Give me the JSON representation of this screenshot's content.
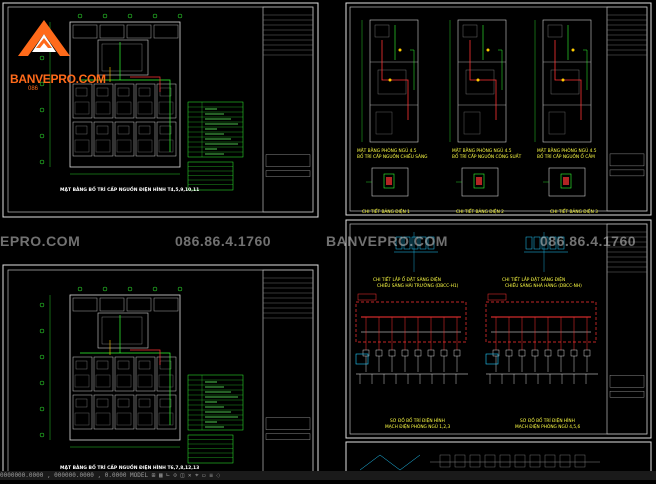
{
  "watermarks": {
    "banvepro_left": "EPRO.COM",
    "phone_left": "086.86.4.1760",
    "banvepro_right": "BANVEPRO.COM",
    "phone_right": "086.86.4.1760"
  },
  "logo": {
    "name": "BANVEPRO.COM",
    "phone": "086"
  },
  "sheets": {
    "sheet1": {
      "title": "MẶT BẰNG BỐ TRÍ CẤP NGUỒN ĐIỆN HÌNH T4,5,9,10,11",
      "legend_title": "GHI CHÚ"
    },
    "sheet2": {
      "plan1": "MẶT BẰNG PHÒNG NGỦ 4.5",
      "plan1_sub": "BỐ TRÍ CẤP NGUỒN CHIẾU SÁNG",
      "plan2": "MẶT BẰNG PHÒNG NGỦ 4.5",
      "plan2_sub": "BỐ TRÍ CẤP NGUỒN CÔNG SUẤT",
      "plan3": "MẶT BẰNG PHÒNG NGỦ 4.5",
      "plan3_sub": "BỐ TRÍ CẤP NGUỒN Ổ CẮM",
      "detail1": "CHI TIẾT BẢNG ĐIỆN 1",
      "detail2": "CHI TIẾT BẢNG ĐIỆN 2",
      "detail3": "CHI TIẾT BẢNG ĐIỆN 3"
    },
    "sheet3": {
      "title": "MẶT BẰNG BỐ TRÍ CẤP NGUỒN ĐIỆN HÌNH T6,7,8,12,13"
    },
    "sheet4": {
      "detail_a": "CHI TIẾT LẮP Ổ ĐẶT SÀNG ĐIỆN",
      "detail_a_sub": "CHIẾU SÁNG HÀI TRƯỜNG (DBCC-H1)",
      "detail_b": "CHI TIẾT LẮP ĐẶT SÀNG ĐIỆN",
      "detail_b_sub": "CHIẾU SÁNG NHÀ HÀNG (DBCC-NH)",
      "diagram_a": "SƠ ĐỒ BỐ TRÍ ĐIỆN HÌNH",
      "diagram_a_sub": "MẠCH ĐIỆN PHÒNG NGỦ 1,2,3",
      "diagram_b": "SƠ ĐỒ BỐ TRÍ ĐIỆN HÌNH",
      "diagram_b_sub": "MẠCH ĐIỆN PHÒNG NGỦ 4,5,6"
    }
  },
  "statusbar": "  0000000.0000 , 000000.0000 , 0.0000    MODEL   ⊞ ▦ ∟ ⊙ ◫ ✕ ⌖ ▭ ≡ ◌"
}
